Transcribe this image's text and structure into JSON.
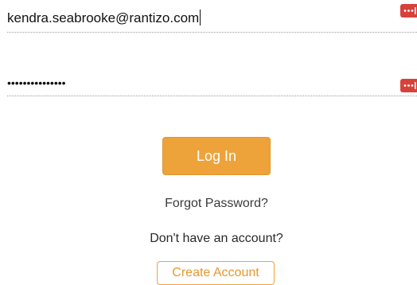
{
  "form": {
    "email": {
      "value": "kendra.seabrooke@rantizo.com"
    },
    "password": {
      "value": "•••••••••••••••"
    },
    "password_manager_icon": "password-manager-icon",
    "login_label": "Log In",
    "forgot_password_label": "Forgot Password?",
    "no_account_text": "Don't have an account?",
    "create_account_label": "Create Account"
  },
  "colors": {
    "accent": "#eea33a",
    "password_manager": "#d8413a"
  }
}
